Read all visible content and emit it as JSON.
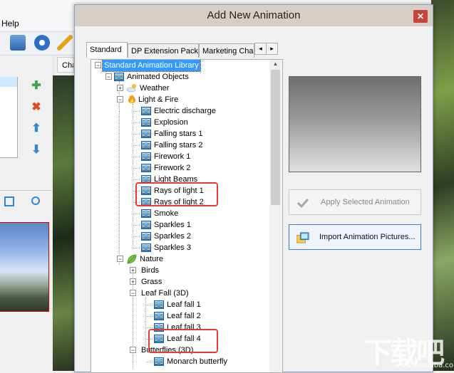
{
  "background_app": {
    "menu_help": "Help",
    "tab_partial": "Cha"
  },
  "dialog": {
    "title": "Add New Animation",
    "close_glyph": "✕",
    "tabs": [
      {
        "label": "Standard",
        "active": true
      },
      {
        "label": "DP Extension Pack",
        "active": false
      },
      {
        "label": "Marketing Char",
        "active": false
      }
    ],
    "tab_scroll_left": "◂",
    "tab_scroll_right": "▸",
    "tree": [
      {
        "label": "Standard Animation Library",
        "depth": 0,
        "expander": "-",
        "icon": "",
        "selected": true
      },
      {
        "label": "Animated Objects",
        "depth": 1,
        "expander": "-",
        "icon": "film-icon"
      },
      {
        "label": "Weather",
        "depth": 2,
        "expander": "+",
        "icon": "cloud-sun-icon"
      },
      {
        "label": "Light & Fire",
        "depth": 2,
        "expander": "-",
        "icon": "fire-icon"
      },
      {
        "label": "Electric discharge",
        "depth": 3,
        "icon": "film-icon"
      },
      {
        "label": "Explosion",
        "depth": 3,
        "icon": "film-icon"
      },
      {
        "label": "Falling stars 1",
        "depth": 3,
        "icon": "film-icon"
      },
      {
        "label": "Falling stars 2",
        "depth": 3,
        "icon": "film-icon"
      },
      {
        "label": "Firework 1",
        "depth": 3,
        "icon": "film-icon"
      },
      {
        "label": "Firework 2",
        "depth": 3,
        "icon": "film-icon"
      },
      {
        "label": "Light Beams",
        "depth": 3,
        "icon": "film-icon"
      },
      {
        "label": "Rays of light 1",
        "depth": 3,
        "icon": "film-icon",
        "highlighted": true
      },
      {
        "label": "Rays of light 2",
        "depth": 3,
        "icon": "film-icon"
      },
      {
        "label": "Smoke",
        "depth": 3,
        "icon": "film-icon"
      },
      {
        "label": "Sparkles 1",
        "depth": 3,
        "icon": "film-icon"
      },
      {
        "label": "Sparkles 2",
        "depth": 3,
        "icon": "film-icon"
      },
      {
        "label": "Sparkles 3",
        "depth": 3,
        "icon": "film-icon"
      },
      {
        "label": "Nature",
        "depth": 2,
        "expander": "-",
        "icon": "leaf-icon"
      },
      {
        "label": "Birds",
        "depth": 3,
        "expander": "+",
        "icon": ""
      },
      {
        "label": "Grass",
        "depth": 3,
        "expander": "+",
        "icon": ""
      },
      {
        "label": "Leaf Fall (3D)",
        "depth": 3,
        "expander": "-",
        "icon": ""
      },
      {
        "label": "Leaf fall 1",
        "depth": 4,
        "icon": "film-icon"
      },
      {
        "label": "Leaf fall 2",
        "depth": 4,
        "icon": "film-icon"
      },
      {
        "label": "Leaf fall 3",
        "depth": 4,
        "icon": "film-icon"
      },
      {
        "label": "Leaf fall 4",
        "depth": 4,
        "icon": "film-icon",
        "highlighted": true
      },
      {
        "label": "Butterflies (3D)",
        "depth": 3,
        "expander": "-",
        "icon": ""
      },
      {
        "label": "Monarch butterfly",
        "depth": 4,
        "icon": "film-icon"
      }
    ],
    "apply_button": {
      "label": "Apply Selected Animation",
      "enabled": false,
      "icon": "checkmark-icon"
    },
    "import_button": {
      "label": "Import Animation Pictures...",
      "icon": "import-pictures-icon"
    }
  },
  "watermark": {
    "text": "下载吧",
    "url": "www.xiazaiba.com"
  },
  "colors": {
    "selection": "#3399ff",
    "annotation": "#e53b3b",
    "dialog_border": "#8aa0bf"
  }
}
